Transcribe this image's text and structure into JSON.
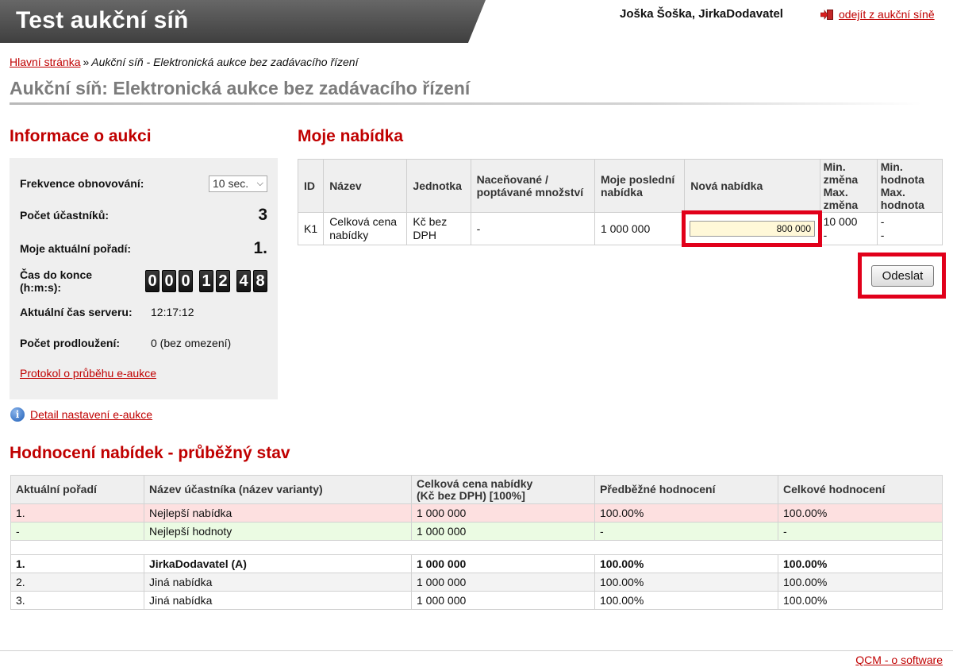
{
  "header": {
    "brand": "Test aukční síň",
    "user": "Joška Šoška, JirkaDodavatel",
    "logout": "odejít z aukční síně"
  },
  "breadcrumb": {
    "home": "Hlavní stránka",
    "separator": "»",
    "current": "Aukční síň - Elektronická aukce bez zadávacího řízení"
  },
  "page_title": "Aukční síň: Elektronická aukce bez zadávacího řízení",
  "info": {
    "heading": "Informace o aukci",
    "refresh_label": "Frekvence obnovování:",
    "refresh_value": "10 sec.",
    "participants_label": "Počet účastníků:",
    "participants_value": "3",
    "rank_label": "Moje aktuální pořadí:",
    "rank_value": "1.",
    "time_label": "Čas do konce (h:m:s):",
    "timer": {
      "h1": "0",
      "h2": "0",
      "h3": "0",
      "m1": "1",
      "m2": "2",
      "s1": "4",
      "s2": "8"
    },
    "server_time_label": "Aktuální čas serveru:",
    "server_time_value": "12:17:12",
    "extensions_label": "Počet prodloužení:",
    "extensions_value": "0 (bez omezení)",
    "protocol_link": "Protokol o průběhu e-aukce",
    "detail_link": "Detail nastavení e-aukce"
  },
  "offer": {
    "heading": "Moje nabídka",
    "columns": {
      "id": "ID",
      "name": "Název",
      "unit": "Jednotka",
      "qty_1": "Naceňované /",
      "qty_2": "poptávané množství",
      "last_1": "Moje poslední",
      "last_2": "nabídka",
      "new_bid": "Nová nabídka",
      "min_1": "Min.",
      "min_2": "změna",
      "max_1": "Max.",
      "max_2": "změna",
      "minv_1": "Min.",
      "minv_2": "hodnota",
      "maxv_1": "Max.",
      "maxv_2": "hodnota"
    },
    "row": {
      "id": "K1",
      "name_1": "Celková cena",
      "name_2": "nabídky",
      "unit_1": "Kč bez",
      "unit_2": "DPH",
      "qty": "-",
      "last": "1 000 000",
      "new_bid_value": "800 000",
      "min_change": "10 000",
      "max_change": "-",
      "min_value": "-",
      "max_value": "-"
    },
    "submit": "Odeslat"
  },
  "evaluation": {
    "heading": "Hodnocení nabídek - průběžný stav",
    "columns": {
      "rank": "Aktuální pořadí",
      "participant": "Název účastníka (název varianty)",
      "price_1": "Celková cena nabídky",
      "price_2": "(Kč bez DPH) [100%]",
      "prelim": "Předběžné hodnocení",
      "total": "Celkové hodnocení"
    },
    "rows": [
      {
        "rank": "1.",
        "name": "Nejlepší nabídka",
        "price": "1 000 000",
        "prelim": "100.00%",
        "total": "100.00%"
      },
      {
        "rank": "-",
        "name": "Nejlepší hodnoty",
        "price": "1 000 000",
        "prelim": "-",
        "total": "-"
      },
      {
        "rank": "1.",
        "name": "JirkaDodavatel (A)",
        "price": "1 000 000",
        "prelim": "100.00%",
        "total": "100.00%"
      },
      {
        "rank": "2.",
        "name": "Jiná nabídka",
        "price": "1 000 000",
        "prelim": "100.00%",
        "total": "100.00%"
      },
      {
        "rank": "3.",
        "name": "Jiná nabídka",
        "price": "1 000 000",
        "prelim": "100.00%",
        "total": "100.00%"
      }
    ]
  },
  "footer": {
    "link": "QCM - o software"
  },
  "colors": {
    "accent": "#c00000",
    "highlight": "#e1001a",
    "header_bg": "#4f4f4f"
  }
}
